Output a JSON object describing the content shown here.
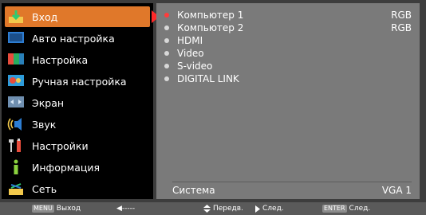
{
  "sidebar": {
    "items": [
      {
        "label": "Вход",
        "icon": "input-icon",
        "selected": true
      },
      {
        "label": "Авто настройка",
        "icon": "auto-setup-icon"
      },
      {
        "label": "Настройка",
        "icon": "image-adjust-icon"
      },
      {
        "label": "Ручная настройка",
        "icon": "manual-setup-icon"
      },
      {
        "label": "Экран",
        "icon": "screen-icon"
      },
      {
        "label": "Звук",
        "icon": "sound-icon"
      },
      {
        "label": "Настройки",
        "icon": "settings-icon"
      },
      {
        "label": "Информация",
        "icon": "information-icon"
      },
      {
        "label": "Сеть",
        "icon": "network-icon"
      }
    ]
  },
  "content": {
    "sources": [
      {
        "name": "Компьютер 1",
        "value": "RGB",
        "active": true
      },
      {
        "name": "Компьютер 2",
        "value": "RGB"
      },
      {
        "name": "HDMI",
        "value": ""
      },
      {
        "name": "Video",
        "value": ""
      },
      {
        "name": "S-video",
        "value": ""
      },
      {
        "name": "DIGITAL LINK",
        "value": ""
      }
    ],
    "system": {
      "label": "Система",
      "value": "VGA 1"
    }
  },
  "footer": {
    "menu_key": "MENU",
    "exit": "Выход",
    "back_arrow": "◀-----",
    "move": "Передв.",
    "next": "След.",
    "enter_key": "ENTER",
    "enter_next": "След."
  },
  "colors": {
    "selected": "#e0782a",
    "active_bullet": "#ff3b3b",
    "content_bg": "#7a7a7a",
    "sidebar_bg": "#000000"
  }
}
